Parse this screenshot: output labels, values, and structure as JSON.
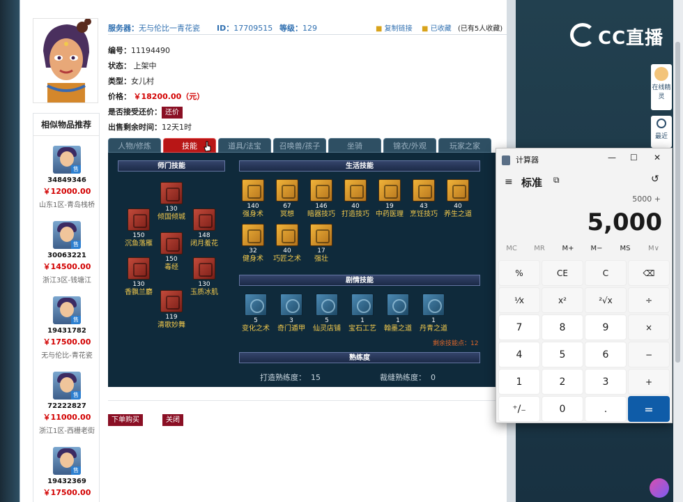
{
  "header": {
    "server_label": "服务器：",
    "server": "无与伦比一青花瓷",
    "id_label": "ID：",
    "id": "17709515",
    "level_label": "等级：",
    "level": "129",
    "copy_link": "复制链接",
    "favorited": "已收藏",
    "fav_count": "(已有5人收藏)"
  },
  "info": {
    "number_label": "编号：",
    "number": "11194490",
    "status_label": "状态：",
    "status": "上架中",
    "type_label": "类型：",
    "type": "女儿村",
    "price_label": "价格：",
    "price": "￥18200.00（元）",
    "bargain_label": "是否接受还价：",
    "bargain_btn": "还价",
    "remaining_label": "出售剩余时间：",
    "remaining": "12天1时"
  },
  "sidebar": {
    "title": "相似物品推荐",
    "items": [
      {
        "id": "34849346",
        "price": "￥12000.00",
        "server": "山东1区-青岛栈桥"
      },
      {
        "id": "30063221",
        "price": "￥14500.00",
        "server": "浙江3区-钱塘江"
      },
      {
        "id": "19431782",
        "price": "￥17500.00",
        "server": "无与伦比-青花瓷"
      },
      {
        "id": "72222827",
        "price": "￥11000.00",
        "server": "浙江1区-西栅老街"
      },
      {
        "id": "19432369",
        "price": "￥17500.00",
        "server": ""
      }
    ],
    "sell_tag": "售"
  },
  "tabs": [
    "人物/修炼",
    "技能",
    "道具/法宝",
    "召唤兽/孩子",
    "坐骑",
    "锦衣/外观",
    "玩家之家"
  ],
  "skills": {
    "sect_title": "师门技能",
    "life_title": "生活技能",
    "story_title": "剧情技能",
    "prof_title": "熟练度",
    "sect": [
      {
        "n": "130",
        "l": "倾国倾城"
      },
      {
        "n": "150",
        "l": "沉鱼落雁"
      },
      {
        "n": "148",
        "l": "闭月羞花"
      },
      {
        "n": "150",
        "l": "毒经"
      },
      {
        "n": "130",
        "l": "香飘兰麝"
      },
      {
        "n": "130",
        "l": "玉质冰肌"
      },
      {
        "n": "119",
        "l": "清歌妙舞"
      }
    ],
    "life": [
      {
        "n": "140",
        "l": "强身术"
      },
      {
        "n": "67",
        "l": "冥想"
      },
      {
        "n": "146",
        "l": "暗器技巧"
      },
      {
        "n": "40",
        "l": "打造技巧"
      },
      {
        "n": "19",
        "l": "中药医理"
      },
      {
        "n": "43",
        "l": "烹饪技巧"
      },
      {
        "n": "40",
        "l": "养生之道"
      },
      {
        "n": "32",
        "l": "健身术"
      },
      {
        "n": "40",
        "l": "巧匠之术"
      },
      {
        "n": "17",
        "l": "强壮"
      }
    ],
    "story": [
      {
        "n": "5",
        "l": "变化之术"
      },
      {
        "n": "3",
        "l": "奇门遁甲"
      },
      {
        "n": "5",
        "l": "仙灵店铺"
      },
      {
        "n": "1",
        "l": "宝石工艺"
      },
      {
        "n": "1",
        "l": "翰墨之道"
      },
      {
        "n": "1",
        "l": "丹青之道"
      }
    ],
    "remaining_points": "剩余技能点：12",
    "forge_label": "打造熟练度：",
    "forge_val": "15",
    "sew_label": "裁缝熟练度：",
    "sew_val": "0"
  },
  "actions": {
    "buy": "下单购买",
    "close": "关闭"
  },
  "right": {
    "logo": "CC直播",
    "sprite": "在线精灵",
    "recent": "最近"
  },
  "calculator": {
    "title": "计算器",
    "mode": "标准",
    "expression": "5000 +",
    "display": "5,000",
    "memory": [
      "MC",
      "MR",
      "M+",
      "M−",
      "MS",
      "M∨"
    ],
    "keys": [
      [
        "%",
        "CE",
        "C",
        "⌫"
      ],
      [
        "¹⁄x",
        "x²",
        "²√x",
        "÷"
      ],
      [
        "7",
        "8",
        "9",
        "×"
      ],
      [
        "4",
        "5",
        "6",
        "−"
      ],
      [
        "1",
        "2",
        "3",
        "+"
      ],
      [
        "⁺/₋",
        "0",
        ".",
        "="
      ]
    ]
  }
}
